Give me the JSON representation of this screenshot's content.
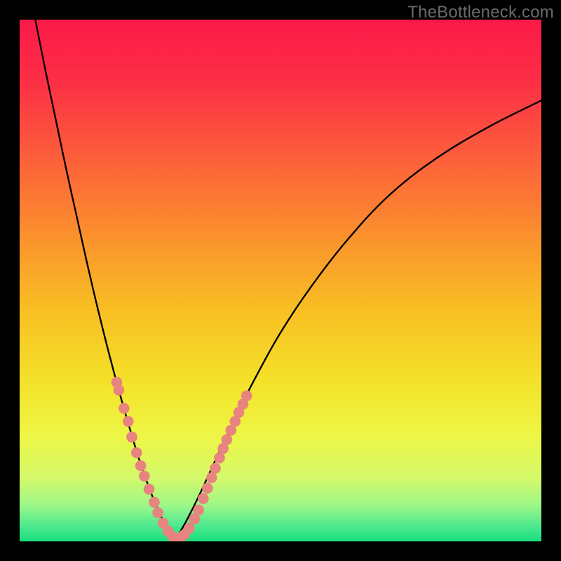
{
  "watermark": "TheBottleneck.com",
  "colors": {
    "frame": "#000000",
    "curve": "#000000",
    "dots": "#e8847f",
    "gradient_stops": [
      {
        "offset": 0.0,
        "color": "#fb1948"
      },
      {
        "offset": 0.12,
        "color": "#fc2f45"
      },
      {
        "offset": 0.25,
        "color": "#fc5a3c"
      },
      {
        "offset": 0.4,
        "color": "#fb8c2e"
      },
      {
        "offset": 0.55,
        "color": "#f8bd23"
      },
      {
        "offset": 0.7,
        "color": "#f4e32a"
      },
      {
        "offset": 0.8,
        "color": "#edf646"
      },
      {
        "offset": 0.88,
        "color": "#d3f96a"
      },
      {
        "offset": 0.93,
        "color": "#9ef787"
      },
      {
        "offset": 0.97,
        "color": "#4fe98f"
      },
      {
        "offset": 1.0,
        "color": "#17de7f"
      }
    ]
  },
  "chart_data": {
    "type": "line",
    "title": "",
    "xlabel": "",
    "ylabel": "",
    "xlim": [
      0,
      100
    ],
    "ylim": [
      0,
      100
    ],
    "grid": false,
    "series": [
      {
        "name": "left-curve",
        "x": [
          3,
          5,
          7,
          9,
          11,
          13,
          15,
          17,
          19,
          21,
          22.5,
          24,
          25.5,
          27,
          28.5,
          30
        ],
        "y": [
          100,
          90,
          80.5,
          71,
          62,
          53,
          44.5,
          36.5,
          29,
          22,
          17,
          12.5,
          8.5,
          5,
          2.3,
          0.5
        ]
      },
      {
        "name": "right-curve",
        "x": [
          30,
          32,
          34.5,
          37.5,
          41,
          45,
          50,
          56,
          63,
          71,
          80,
          90,
          100
        ],
        "y": [
          0.5,
          4,
          9,
          15.5,
          23,
          31,
          40,
          49,
          58,
          66.5,
          73.5,
          79.5,
          84.5
        ]
      }
    ],
    "dots": {
      "name": "highlight-dots",
      "points": [
        {
          "x": 18.6,
          "y": 30.5
        },
        {
          "x": 19.0,
          "y": 29.0
        },
        {
          "x": 20.0,
          "y": 25.5
        },
        {
          "x": 20.8,
          "y": 23.0
        },
        {
          "x": 21.5,
          "y": 20.0
        },
        {
          "x": 22.4,
          "y": 17.0
        },
        {
          "x": 23.2,
          "y": 14.5
        },
        {
          "x": 23.9,
          "y": 12.5
        },
        {
          "x": 24.8,
          "y": 10.0
        },
        {
          "x": 25.8,
          "y": 7.5
        },
        {
          "x": 26.5,
          "y": 5.5
        },
        {
          "x": 27.5,
          "y": 3.5
        },
        {
          "x": 28.4,
          "y": 2.0
        },
        {
          "x": 29.2,
          "y": 1.0
        },
        {
          "x": 30.0,
          "y": 0.6
        },
        {
          "x": 30.8,
          "y": 0.7
        },
        {
          "x": 31.6,
          "y": 1.3
        },
        {
          "x": 32.5,
          "y": 2.5
        },
        {
          "x": 33.5,
          "y": 4.3
        },
        {
          "x": 34.3,
          "y": 6.0
        },
        {
          "x": 35.2,
          "y": 8.2
        },
        {
          "x": 36.0,
          "y": 10.2
        },
        {
          "x": 36.8,
          "y": 12.2
        },
        {
          "x": 37.5,
          "y": 14.0
        },
        {
          "x": 38.3,
          "y": 16.0
        },
        {
          "x": 39.0,
          "y": 17.8
        },
        {
          "x": 39.7,
          "y": 19.5
        },
        {
          "x": 40.5,
          "y": 21.3
        },
        {
          "x": 41.3,
          "y": 23.0
        },
        {
          "x": 42.0,
          "y": 24.7
        },
        {
          "x": 42.8,
          "y": 26.3
        },
        {
          "x": 43.5,
          "y": 27.9
        }
      ]
    },
    "minimum_x": 30
  }
}
